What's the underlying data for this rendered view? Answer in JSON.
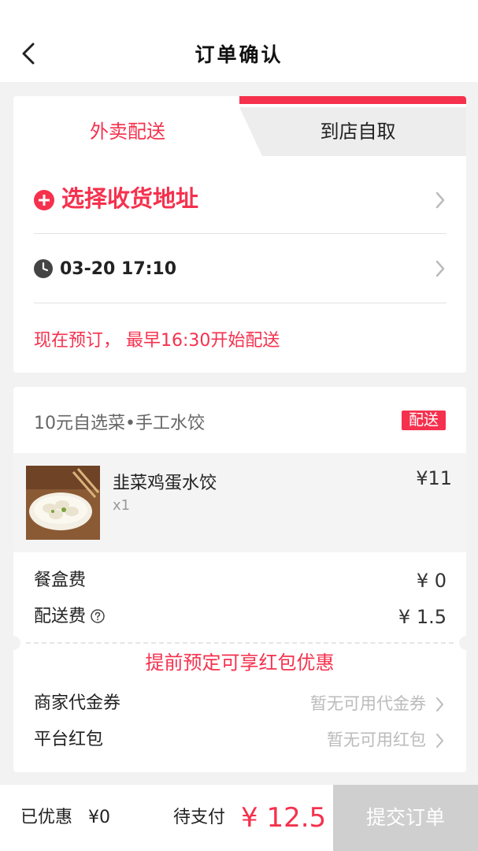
{
  "header": {
    "title": "订单确认"
  },
  "delivery": {
    "tabs": [
      {
        "label": "外卖配送",
        "active": true
      },
      {
        "label": "到店自取",
        "active": false
      }
    ],
    "address_label": "选择收货地址",
    "time": "03-20 17:10",
    "preorder_note": "现在预订， 最早16:30开始配送"
  },
  "order": {
    "shop_name": "10元自选菜•手工水饺",
    "badge": "配送",
    "items": [
      {
        "name": "韭菜鸡蛋水饺",
        "qty": "x1",
        "price": "¥11"
      }
    ],
    "fees": [
      {
        "label": "餐盒费",
        "value": "¥ 0"
      },
      {
        "label": "配送费",
        "value": "¥ 1.5"
      }
    ],
    "promo": "提前预定可享红包优惠",
    "options": [
      {
        "label": "商家代金券",
        "value": "暂无可用代金券"
      },
      {
        "label": "平台红包",
        "value": "暂无可用红包"
      }
    ]
  },
  "footer": {
    "saved_label": "已优惠",
    "saved_value": "¥0",
    "pay_label": "待支付",
    "pay_value": "¥ 12.5",
    "submit_label": "提交订单"
  },
  "colors": {
    "accent": "#f5314e",
    "disabled_button": "#cfcfcf"
  }
}
